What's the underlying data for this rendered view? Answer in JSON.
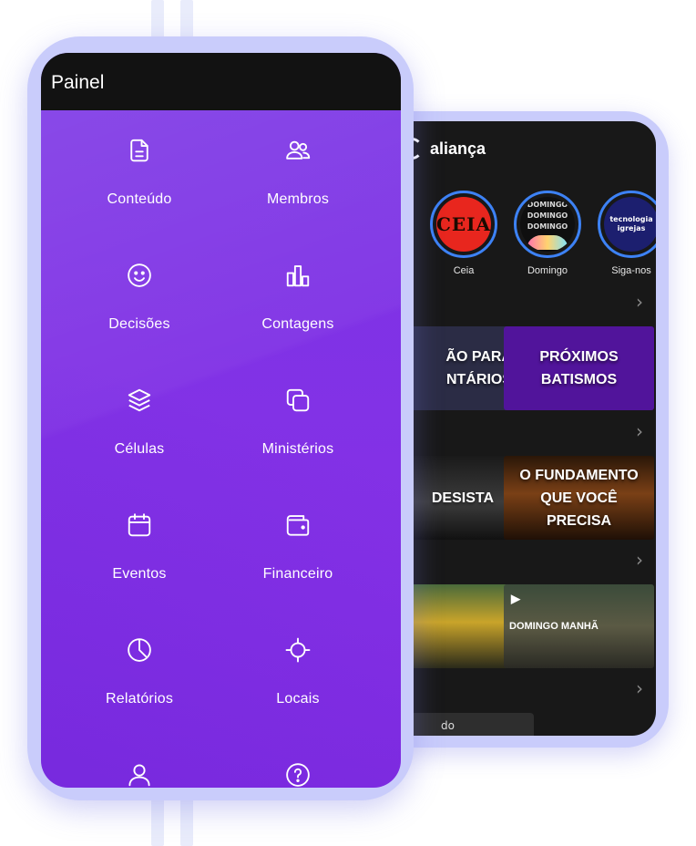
{
  "front": {
    "title": "Painel",
    "menu": [
      {
        "label": "Conteúdo",
        "icon": "document-icon"
      },
      {
        "label": "Membros",
        "icon": "users-icon"
      },
      {
        "label": "Decisões",
        "icon": "smile-icon"
      },
      {
        "label": "Contagens",
        "icon": "bar-chart-icon"
      },
      {
        "label": "Células",
        "icon": "layers-icon"
      },
      {
        "label": "Ministérios",
        "icon": "copy-icon"
      },
      {
        "label": "Eventos",
        "icon": "calendar-icon"
      },
      {
        "label": "Financeiro",
        "icon": "wallet-icon"
      },
      {
        "label": "Relatórios",
        "icon": "pie-chart-icon"
      },
      {
        "label": "Locais",
        "icon": "crosshair-icon"
      },
      {
        "label": "",
        "icon": "user-icon"
      },
      {
        "label": "",
        "icon": "help-icon"
      }
    ]
  },
  "back": {
    "brand": "aliança",
    "stories": [
      {
        "label": "Ceia",
        "art": "CEIA"
      },
      {
        "label": "Domingo",
        "art": [
          "DOMINGO",
          "DOMINGO",
          "DOMINGO"
        ]
      },
      {
        "label": "Siga-nos",
        "art": [
          "tecnologia",
          "igrejas"
        ]
      }
    ],
    "cards": {
      "row1": [
        "ÃO PARA NTÁRIOS",
        "PRÓXIMOS BATISMOS"
      ],
      "row2": [
        "DESISTA",
        "O FUNDAMENTO QUE VOCÊ PRECISA"
      ],
      "row3": [
        "",
        "DOMINGO MANHÃ"
      ]
    },
    "bottom_tab": "do"
  },
  "colors": {
    "accent": "#8a2ee6",
    "frame": "#c9ccfb",
    "story_ring": "#3d82f5"
  }
}
